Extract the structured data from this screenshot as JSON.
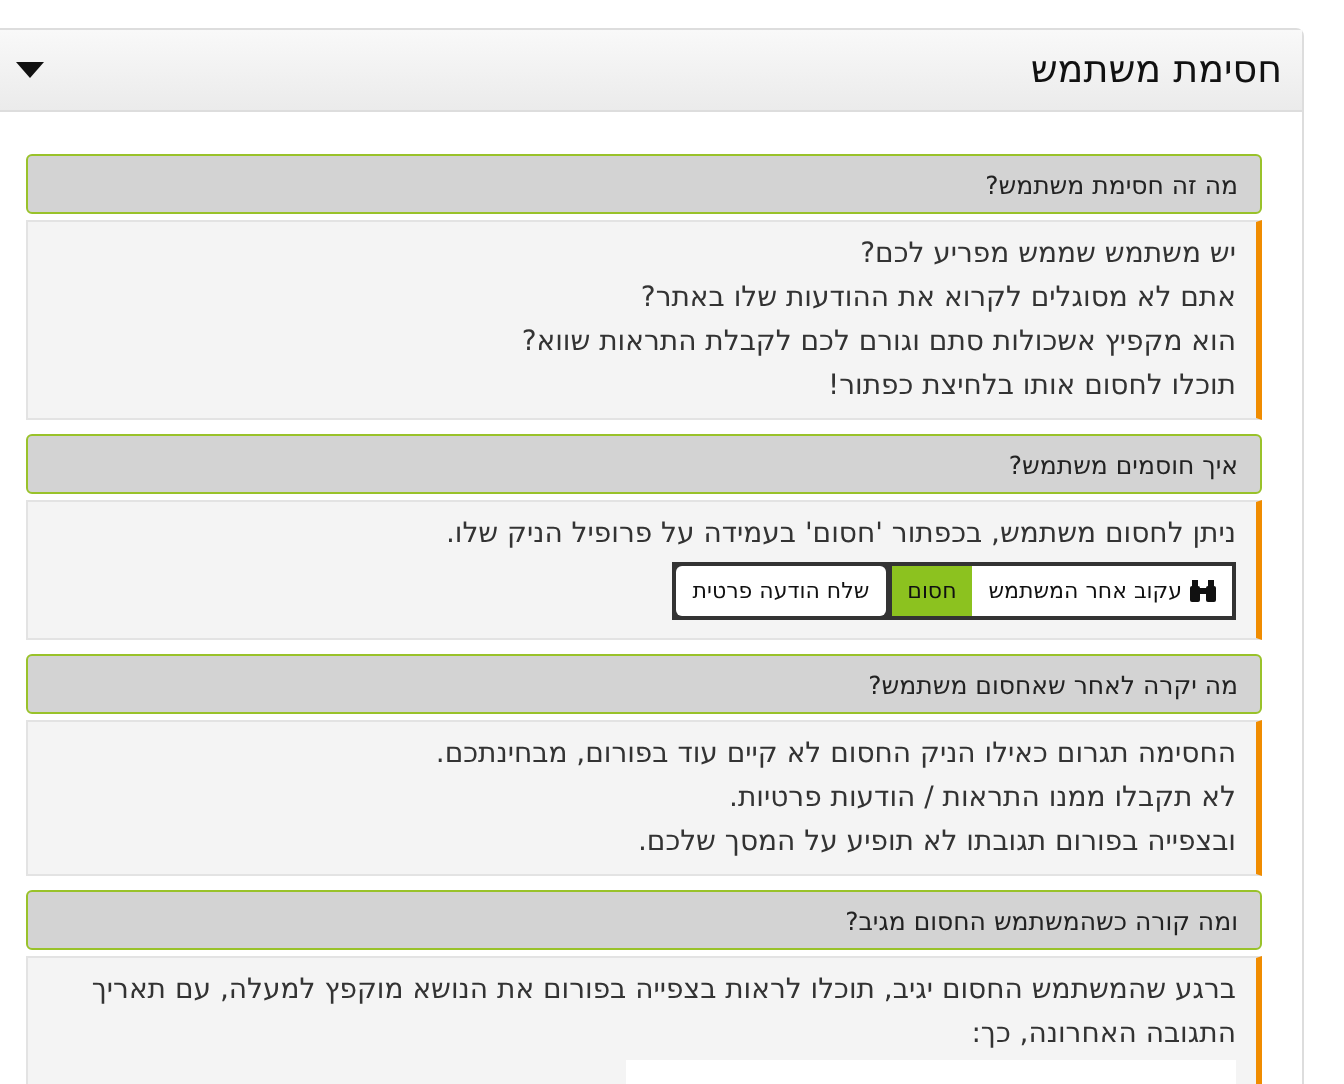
{
  "panel": {
    "title": "חסימת משתמש",
    "expanded": true
  },
  "sections": [
    {
      "question": "מה זה חסימת משתמש?",
      "lines": [
        "יש משתמש שממש מפריע לכם?",
        "אתם לא מסוגלים לקרוא את ההודעות שלו באתר?",
        "הוא מקפיץ אשכולות סתם וגורם לכם לקבלת התראות שווא?",
        "תוכלו לחסום אותו בלחיצת כפתור!"
      ]
    },
    {
      "question": "איך חוסמים משתמש?",
      "lines": [
        "ניתן לחסום משתמש, בכפתור 'חסום' בעמידה על פרופיל הניק שלו."
      ],
      "buttons": [
        {
          "label": "עקוב אחר המשתמש",
          "kind": "follow"
        },
        {
          "label": "חסום",
          "kind": "primary"
        },
        {
          "label": "שלח הודעה פרטית",
          "kind": "plain"
        }
      ]
    },
    {
      "question": "מה יקרה לאחר שאחסום משתמש?",
      "lines": [
        "החסימה תגרום כאילו הניק החסום לא קיים עוד בפורום, מבחינתכם.",
        "לא תקבלו ממנו התראות / הודעות פרטיות.",
        "ובצפייה בפורום תגובתו לא תופיע על המסך שלכם."
      ]
    },
    {
      "question": "ומה קורה כשהמשתמש החסום מגיב?",
      "lines": [
        "ברגע שהמשתמש החסום יגיב, תוכלו לראות בצפייה בפורום את הנושא מוקפץ למעלה, עם תאריך התגובה האחרונה, כך:"
      ]
    }
  ]
}
